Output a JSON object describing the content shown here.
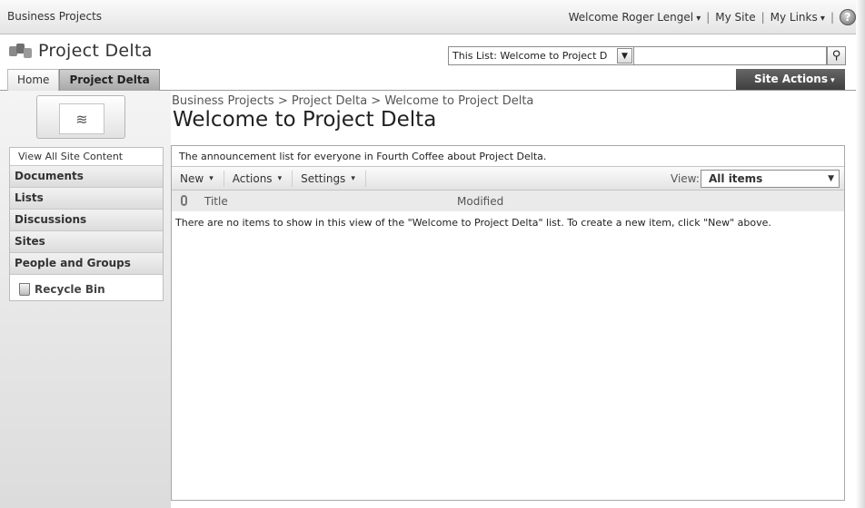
{
  "topbar": {
    "site_name": "Business Projects",
    "welcome": "Welcome Roger Lengel",
    "my_site": "My Site",
    "my_links": "My Links",
    "separator": "|",
    "help_glyph": "?"
  },
  "header": {
    "title": "Project Delta",
    "search_scope": "This List: Welcome to Project D",
    "search_value": "",
    "site_actions": "Site Actions",
    "tabs": [
      {
        "label": "Home",
        "active": false
      },
      {
        "label": "Project Delta",
        "active": true
      }
    ]
  },
  "sidebar": {
    "view_all": "View All Site Content",
    "sections": [
      "Documents",
      "Lists",
      "Discussions",
      "Sites",
      "People and Groups"
    ],
    "recycle_bin": "Recycle Bin"
  },
  "main": {
    "breadcrumb": "Business Projects > Project Delta > Welcome to Project Delta",
    "page_title": "Welcome to Project Delta",
    "description": "The announcement list for everyone in Fourth Coffee about Project Delta.",
    "toolbar": {
      "new": "New",
      "actions": "Actions",
      "settings": "Settings",
      "view_label": "View:",
      "view_value": "All items"
    },
    "columns": {
      "title": "Title",
      "modified": "Modified"
    },
    "empty_message": "There are no items to show in this view of the \"Welcome to Project Delta\" list. To create a new item, click \"New\" above."
  },
  "icons": [
    "help-icon",
    "site-logo-icon",
    "search-icon",
    "chevron-down-icon",
    "site-image-icon",
    "recycle-bin-icon",
    "attachment-icon"
  ]
}
